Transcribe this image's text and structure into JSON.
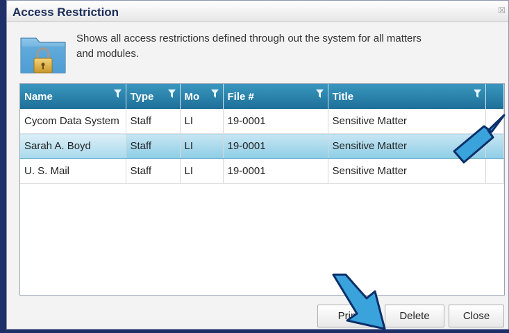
{
  "dialog": {
    "title": "Access Restriction",
    "close_glyph": "☒",
    "description": "Shows all access restrictions defined through out the system for all matters and modules."
  },
  "icons": {
    "folder": "folder-lock-icon",
    "filter": "filter-icon",
    "close": "close-icon"
  },
  "grid": {
    "columns": [
      "Name",
      "Type",
      "Mo",
      "File #",
      "Title"
    ],
    "rows": [
      {
        "name": "Cycom Data System",
        "type": "Staff",
        "mo": "LI",
        "file": "19-0001",
        "title": "Sensitive Matter",
        "selected": false
      },
      {
        "name": "Sarah A. Boyd",
        "type": "Staff",
        "mo": "LI",
        "file": "19-0001",
        "title": "Sensitive Matter",
        "selected": true
      },
      {
        "name": "U. S. Mail",
        "type": "Staff",
        "mo": "LI",
        "file": "19-0001",
        "title": "Sensitive Matter",
        "selected": false
      }
    ]
  },
  "buttons": {
    "print": "Print",
    "delete": "Delete",
    "close": "Close"
  },
  "colors": {
    "header": "#2583ad",
    "selection": "#a9dbee",
    "arrow": "#3aa3dc"
  }
}
